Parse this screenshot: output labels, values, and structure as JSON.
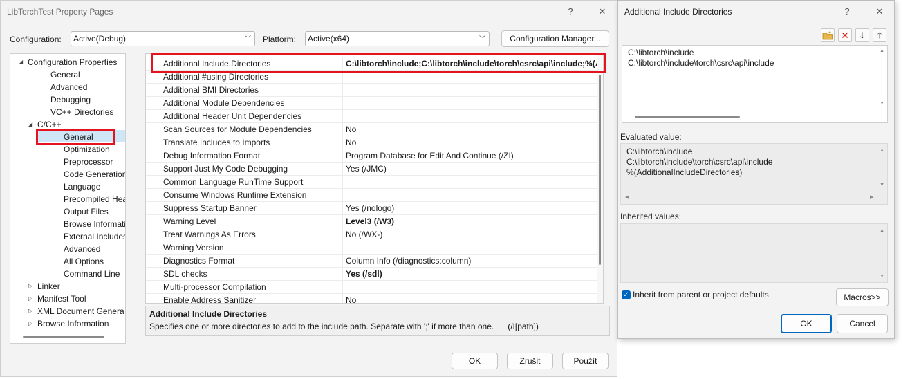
{
  "main": {
    "title": "LibTorchTest Property Pages",
    "help_glyph": "?",
    "close_glyph": "✕",
    "configuration_label": "Configuration:",
    "configuration_value": "Active(Debug)",
    "platform_label": "Platform:",
    "platform_value": "Active(x64)",
    "config_manager_label": "Configuration Manager...",
    "tree": [
      {
        "label": "Configuration Properties",
        "indent": 0,
        "expander": "◢"
      },
      {
        "label": "General",
        "indent": 2,
        "expander": ""
      },
      {
        "label": "Advanced",
        "indent": 2,
        "expander": ""
      },
      {
        "label": "Debugging",
        "indent": 2,
        "expander": ""
      },
      {
        "label": "VC++ Directories",
        "indent": 2,
        "expander": ""
      },
      {
        "label": "C/C++",
        "indent": 1,
        "expander": "◢"
      },
      {
        "label": "General",
        "indent": 3,
        "expander": ""
      },
      {
        "label": "Optimization",
        "indent": 3,
        "expander": ""
      },
      {
        "label": "Preprocessor",
        "indent": 3,
        "expander": ""
      },
      {
        "label": "Code Generation",
        "indent": 3,
        "expander": ""
      },
      {
        "label": "Language",
        "indent": 3,
        "expander": ""
      },
      {
        "label": "Precompiled Heade",
        "indent": 3,
        "expander": ""
      },
      {
        "label": "Output Files",
        "indent": 3,
        "expander": ""
      },
      {
        "label": "Browse Information",
        "indent": 3,
        "expander": ""
      },
      {
        "label": "External Includes",
        "indent": 3,
        "expander": ""
      },
      {
        "label": "Advanced",
        "indent": 3,
        "expander": ""
      },
      {
        "label": "All Options",
        "indent": 3,
        "expander": ""
      },
      {
        "label": "Command Line",
        "indent": 3,
        "expander": ""
      },
      {
        "label": "Linker",
        "indent": 1,
        "expander": "▷"
      },
      {
        "label": "Manifest Tool",
        "indent": 1,
        "expander": "▷"
      },
      {
        "label": "XML Document Genera",
        "indent": 1,
        "expander": "▷"
      },
      {
        "label": "Browse Information",
        "indent": 1,
        "expander": "▷"
      }
    ],
    "properties": [
      {
        "name": "Additional Include Directories",
        "value": "C:\\libtorch\\include;C:\\libtorch\\include\\torch\\csrc\\api\\include;%(AdditionalIncludeDirectories)",
        "bold": true
      },
      {
        "name": "Additional #using Directories",
        "value": "",
        "bold": false
      },
      {
        "name": "Additional BMI Directories",
        "value": "",
        "bold": false
      },
      {
        "name": "Additional Module Dependencies",
        "value": "",
        "bold": false
      },
      {
        "name": "Additional Header Unit Dependencies",
        "value": "",
        "bold": false
      },
      {
        "name": "Scan Sources for Module Dependencies",
        "value": "No",
        "bold": false
      },
      {
        "name": "Translate Includes to Imports",
        "value": "No",
        "bold": false
      },
      {
        "name": "Debug Information Format",
        "value": "Program Database for Edit And Continue (/ZI)",
        "bold": false
      },
      {
        "name": "Support Just My Code Debugging",
        "value": "Yes (/JMC)",
        "bold": false
      },
      {
        "name": "Common Language RunTime Support",
        "value": "",
        "bold": false
      },
      {
        "name": "Consume Windows Runtime Extension",
        "value": "",
        "bold": false
      },
      {
        "name": "Suppress Startup Banner",
        "value": "Yes (/nologo)",
        "bold": false
      },
      {
        "name": "Warning Level",
        "value": "Level3 (/W3)",
        "bold": true
      },
      {
        "name": "Treat Warnings As Errors",
        "value": "No (/WX-)",
        "bold": false
      },
      {
        "name": "Warning Version",
        "value": "",
        "bold": false
      },
      {
        "name": "Diagnostics Format",
        "value": "Column Info (/diagnostics:column)",
        "bold": false
      },
      {
        "name": "SDL checks",
        "value": "Yes (/sdl)",
        "bold": true
      },
      {
        "name": "Multi-processor Compilation",
        "value": "",
        "bold": false
      },
      {
        "name": "Enable Address Sanitizer",
        "value": "No",
        "bold": false
      }
    ],
    "description_title": "Additional Include Directories",
    "description_text": "Specifies one or more directories to add to the include path. Separate with ';' if more than one.      (/I[path])",
    "ok_label": "OK",
    "cancel_label": "Zrušit",
    "apply_label": "Použít"
  },
  "side": {
    "title": "Additional Include Directories",
    "help_glyph": "?",
    "close_glyph": "✕",
    "edit_lines": [
      "C:\\libtorch\\include",
      "C:\\libtorch\\include\\torch\\csrc\\api\\include"
    ],
    "evaluated_label": "Evaluated value:",
    "evaluated_lines": [
      "C:\\libtorch\\include",
      "C:\\libtorch\\include\\torch\\csrc\\api\\include",
      "%(AdditionalIncludeDirectories)"
    ],
    "inherited_label": "Inherited values:",
    "inherit_checkbox_label": "Inherit from parent or project defaults",
    "inherit_checked": true,
    "macros_label": "Macros>>",
    "ok_label": "OK",
    "cancel_label": "Cancel"
  },
  "colors": {
    "highlight_red": "#e3131f",
    "selection_blue": "#cfe6f6",
    "accent": "#0067c0"
  }
}
